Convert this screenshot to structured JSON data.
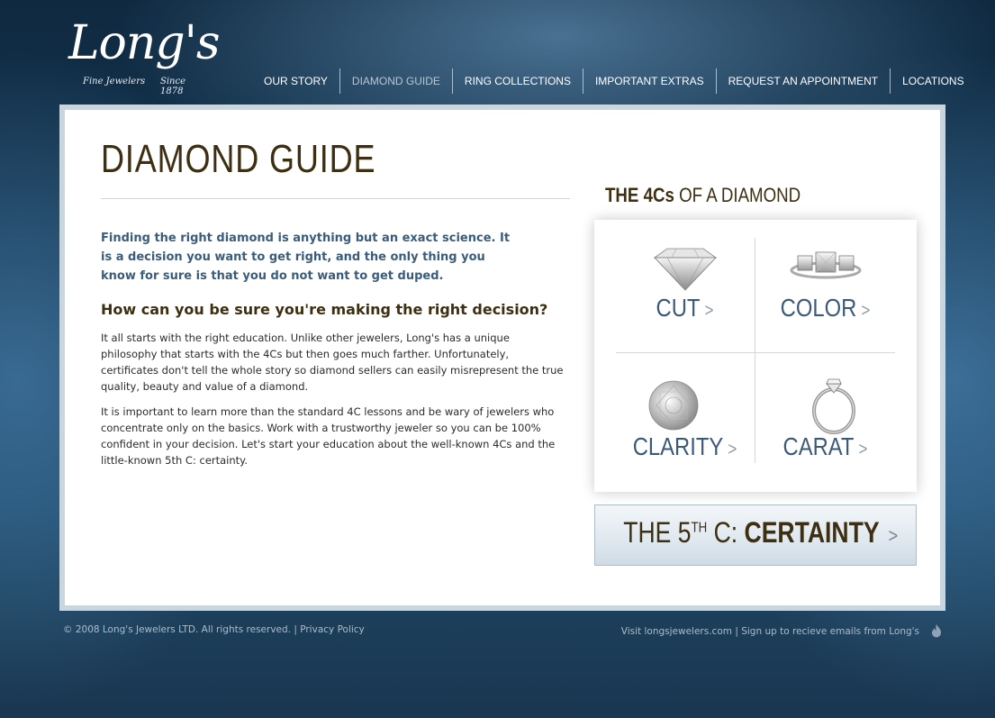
{
  "logo": {
    "script": "Long's",
    "tagline_left": "Fine Jewelers",
    "tagline_right": "Since 1878"
  },
  "nav": [
    {
      "label": "OUR STORY",
      "active": false
    },
    {
      "label": "DIAMOND GUIDE",
      "active": true
    },
    {
      "label": "RING COLLECTIONS",
      "active": false
    },
    {
      "label": "IMPORTANT EXTRAS",
      "active": false
    },
    {
      "label": "REQUEST AN APPOINTMENT",
      "active": false
    },
    {
      "label": "LOCATIONS",
      "active": false
    }
  ],
  "page": {
    "title": "DIAMOND GUIDE",
    "lead": "Finding the right diamond is anything but an exact science. It is a decision you want to get right, and the only thing you know for sure is that you do not want to get duped.",
    "subhead": "How can you be sure you're making the right decision?",
    "paragraph1": "It all starts with the right education. Unlike other jewelers, Long's has a unique philosophy that starts with the 4Cs but then goes much farther. Unfortunately, certificates don't tell the whole story so diamond sellers can easily misrepresent the true quality, beauty and value of a diamond.",
    "paragraph2": "It is important to learn more than the standard 4C lessons and be wary of jewelers who concentrate only on the basics. Work with a trustworthy jeweler so you can be 100% confident in your decision. Let's start your education about the well-known 4Cs and the little-known 5th C: certainty."
  },
  "four_cs": {
    "heading_bold": "THE 4Cs",
    "heading_rest": " OF A DIAMOND",
    "items": [
      {
        "label": "CUT",
        "icon": "round-diamond-side-icon"
      },
      {
        "label": "COLOR",
        "icon": "three-stone-ring-icon"
      },
      {
        "label": "CLARITY",
        "icon": "round-diamond-top-icon"
      },
      {
        "label": "CARAT",
        "icon": "solitaire-ring-icon"
      }
    ],
    "chevron": ">"
  },
  "certainty": {
    "prefix": "THE 5",
    "sup": "TH",
    "middle": " C: ",
    "bold": "CERTAINTY",
    "chevron": ">"
  },
  "footer": {
    "copyright": "© 2008 Long's Jewelers LTD. All rights reserved.",
    "separator": " | ",
    "privacy": "Privacy Policy",
    "visit": "Visit longsjewelers.com",
    "signup": "Sign up to recieve emails from Long's",
    "icon": "flame-icon"
  },
  "colors": {
    "brown": "#3d2f12",
    "blue_text": "#3a5c7c",
    "label_blue": "#3c5a78"
  }
}
